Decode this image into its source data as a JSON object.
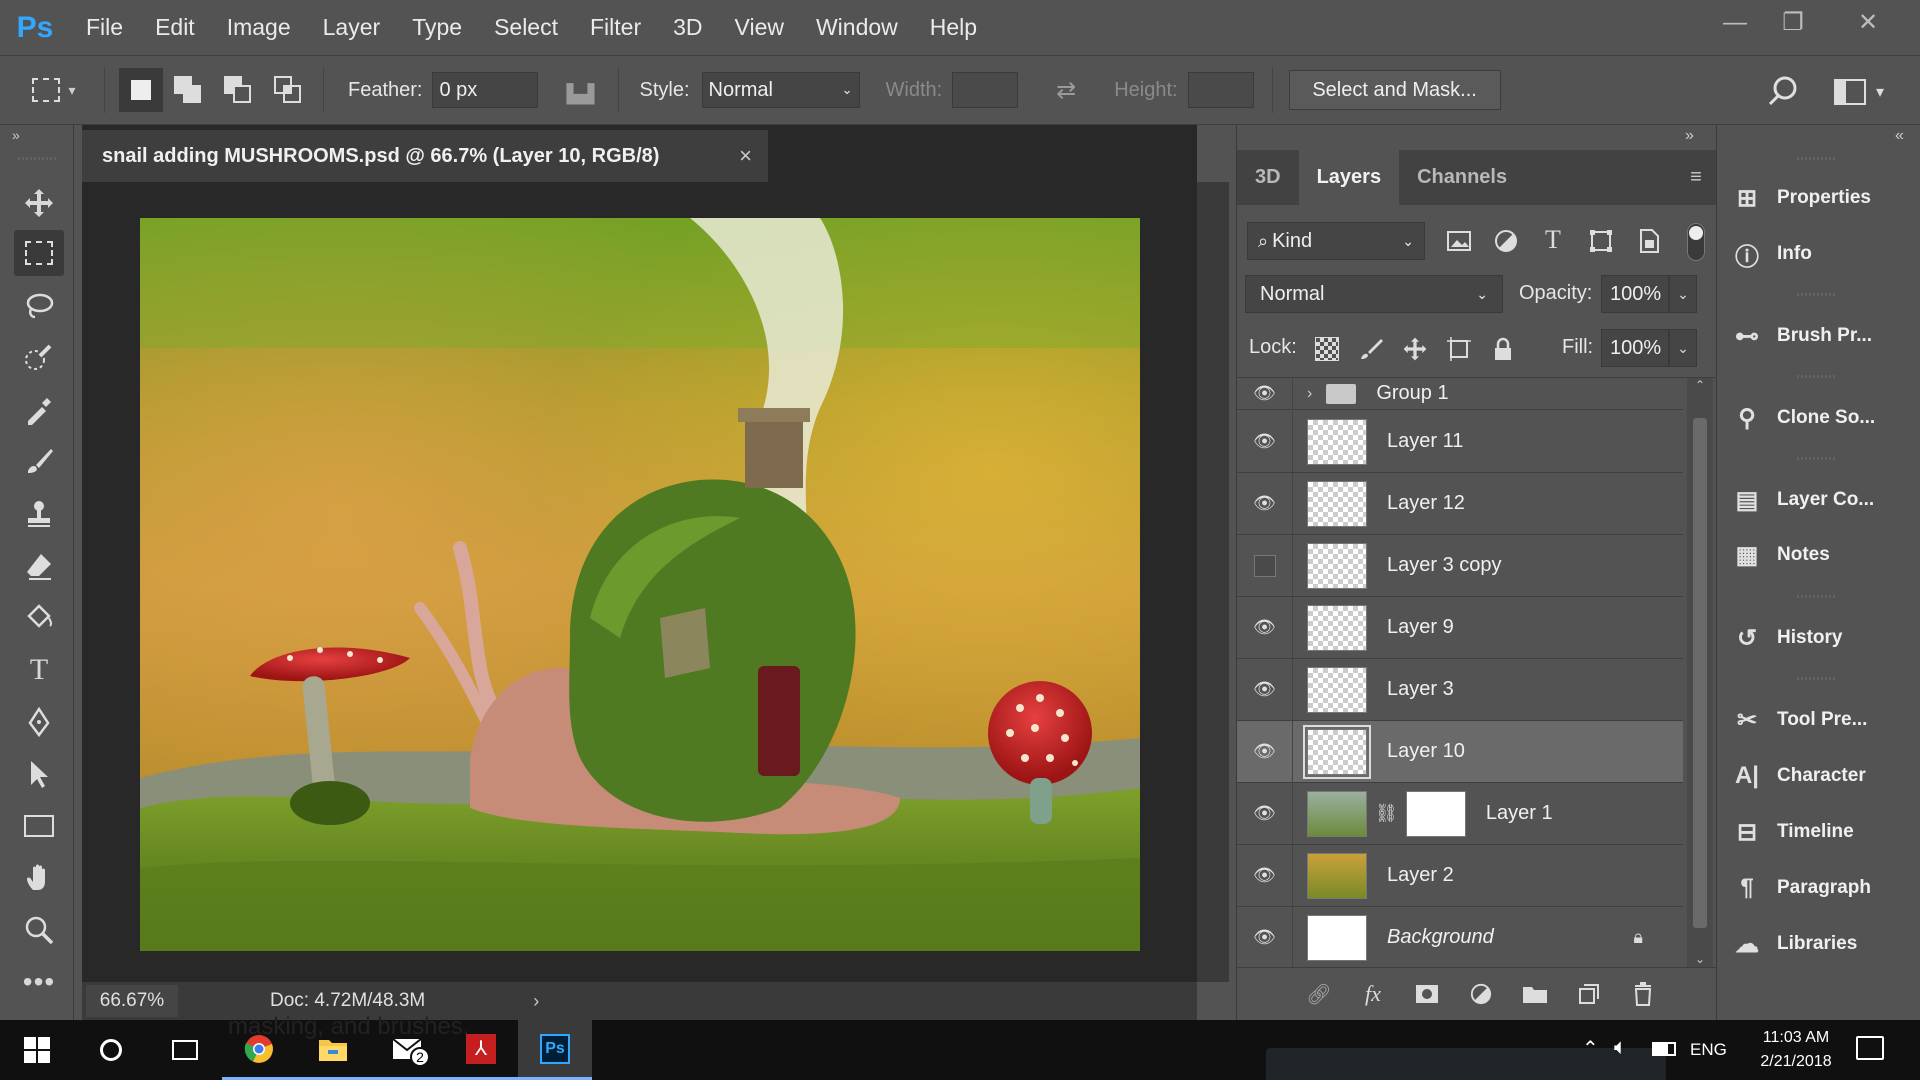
{
  "app": {
    "logo": "Ps",
    "menu": [
      "File",
      "Edit",
      "Image",
      "Layer",
      "Type",
      "Select",
      "Filter",
      "3D",
      "View",
      "Window",
      "Help"
    ]
  },
  "window_controls": {
    "minimize": "—",
    "restore": "❐",
    "close": "✕"
  },
  "options_bar": {
    "feather_label": "Feather:",
    "feather_value": "0 px",
    "style_label": "Style:",
    "style_value": "Normal",
    "width_label": "Width:",
    "height_label": "Height:",
    "select_mask": "Select and Mask..."
  },
  "document": {
    "tab_title": "snail  adding MUSHROOMS.psd @ 66.7% (Layer 10, RGB/8)",
    "close": "×",
    "zoom": "66.67%",
    "doc_info": "Doc: 4.72M/48.3M",
    "overlay_text": "masking, and brushes."
  },
  "layers_panel": {
    "tabs": [
      "3D",
      "Layers",
      "Channels"
    ],
    "active_tab": "Layers",
    "filter_kind": "Kind",
    "blend_mode": "Normal",
    "opacity_label": "Opacity:",
    "opacity_value": "100%",
    "lock_label": "Lock:",
    "fill_label": "Fill:",
    "fill_value": "100%",
    "group": {
      "name": "Group 1"
    },
    "layers": [
      {
        "name": "Layer 11",
        "visible": true
      },
      {
        "name": "Layer 12",
        "visible": true
      },
      {
        "name": "Layer 3 copy",
        "visible": false
      },
      {
        "name": "Layer 9",
        "visible": true
      },
      {
        "name": "Layer 3",
        "visible": true
      },
      {
        "name": "Layer 10",
        "visible": true,
        "selected": true
      },
      {
        "name": "Layer 1",
        "visible": true,
        "has_mask": true
      },
      {
        "name": "Layer 2",
        "visible": true
      },
      {
        "name": "Background",
        "visible": true,
        "locked": true
      }
    ]
  },
  "dock": [
    {
      "label": "Properties",
      "icon": "properties-icon"
    },
    {
      "label": "Info",
      "icon": "info-icon"
    },
    {
      "label": "Brush Pr...",
      "icon": "brush-presets-icon"
    },
    {
      "label": "Clone So...",
      "icon": "clone-source-icon"
    },
    {
      "label": "Layer Co...",
      "icon": "layer-comps-icon"
    },
    {
      "label": "Notes",
      "icon": "notes-icon"
    },
    {
      "label": "History",
      "icon": "history-icon"
    },
    {
      "label": "Tool Pre...",
      "icon": "tool-presets-icon"
    },
    {
      "label": "Character",
      "icon": "character-icon"
    },
    {
      "label": "Timeline",
      "icon": "timeline-icon"
    },
    {
      "label": "Paragraph",
      "icon": "paragraph-icon"
    },
    {
      "label": "Libraries",
      "icon": "libraries-icon"
    }
  ],
  "taskbar": {
    "mail_badge": "2",
    "language": "ENG",
    "time": "11:03 AM",
    "date": "2/21/2018"
  }
}
